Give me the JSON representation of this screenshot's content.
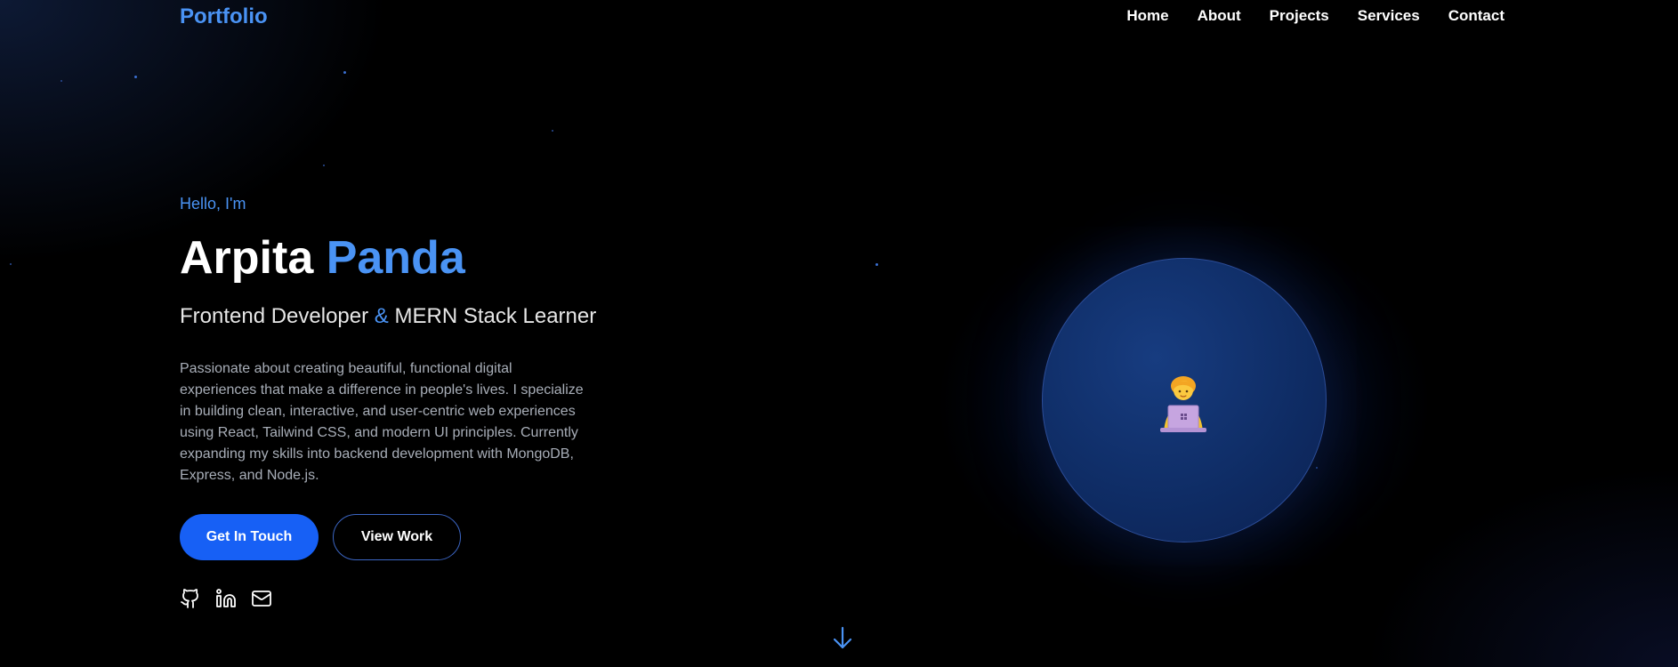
{
  "nav": {
    "logo": "Portfolio",
    "links": [
      {
        "label": "Home"
      },
      {
        "label": "About"
      },
      {
        "label": "Projects"
      },
      {
        "label": "Services"
      },
      {
        "label": "Contact"
      }
    ]
  },
  "hero": {
    "greeting": "Hello, I'm",
    "name_first": "Arpita",
    "name_last": "Panda",
    "role_part1": "Frontend Developer",
    "role_amp": "&",
    "role_part2": "MERN Stack Learner",
    "bio": "Passionate about creating beautiful, functional digital experiences that make a difference in people's lives. I specialize in building clean, interactive, and user-centric web experiences using React, Tailwind CSS, and modern UI principles. Currently expanding my skills into backend development with MongoDB, Express, and Node.js.",
    "primary_button": "Get In Touch",
    "secondary_button": "View Work"
  },
  "social": {
    "icons": [
      "github-icon",
      "linkedin-icon",
      "mail-icon"
    ]
  },
  "avatar": {
    "icon": "person-with-laptop-icon"
  },
  "colors": {
    "accent": "#4a93f4",
    "primary_button": "#1760f5",
    "background": "#000000",
    "avatar_circle": "#0f2d66"
  }
}
